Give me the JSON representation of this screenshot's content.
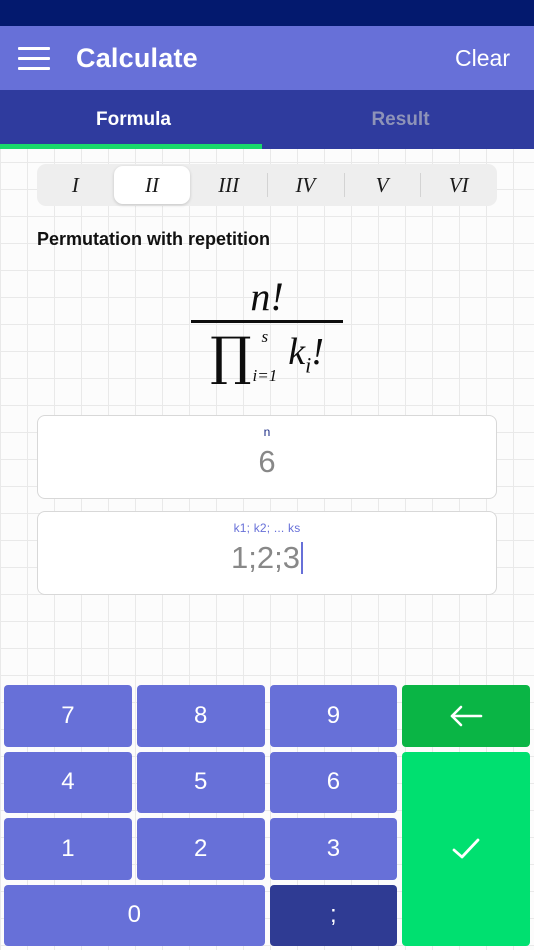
{
  "statusbar": {
    "color": "#03196e"
  },
  "appbar": {
    "menu_icon": "hamburger-menu-icon",
    "title": "Calculate",
    "clear_label": "Clear",
    "color": "#6770d8"
  },
  "tabs": {
    "color": "#2f3b9e",
    "indicator_color": "#19d96b",
    "items": [
      {
        "label": "Formula",
        "active": true
      },
      {
        "label": "Result",
        "active": false
      }
    ]
  },
  "segmented": {
    "items": [
      {
        "label": "I",
        "active": false
      },
      {
        "label": "II",
        "active": true
      },
      {
        "label": "III",
        "active": false
      },
      {
        "label": "IV",
        "active": false
      },
      {
        "label": "V",
        "active": false
      },
      {
        "label": "VI",
        "active": false
      }
    ]
  },
  "section": {
    "title": "Permutation with repetition"
  },
  "formula": {
    "numerator": "n!",
    "product_symbol": "∏",
    "product_upper": "s",
    "product_lower": "i=1",
    "denominator_term": "k",
    "denominator_sub": "i",
    "denominator_suffix": "!"
  },
  "fields": [
    {
      "label": "n",
      "value": "6",
      "focused": false,
      "label_color": "#1d2d86"
    },
    {
      "label": "k1; k2; ... ks",
      "value": "1;2;3",
      "focused": true,
      "label_color": "#6770d8"
    }
  ],
  "keypad": {
    "num_color": "#6770d8",
    "semi_color": "#2f3b93",
    "back_color": "#0ab545",
    "ok_color": "#00e070",
    "keys": {
      "k7": "7",
      "k8": "8",
      "k9": "9",
      "k4": "4",
      "k5": "5",
      "k6": "6",
      "k1": "1",
      "k2": "2",
      "k3": "3",
      "k0": "0",
      "semicolon": ";",
      "backspace_icon": "arrow-left-icon",
      "confirm_icon": "check-icon"
    }
  }
}
